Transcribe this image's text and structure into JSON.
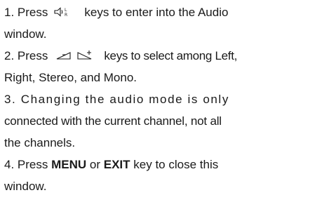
{
  "instructions": {
    "step1": {
      "before": "1. Press",
      "icon": "audio-speaker-lr-icon",
      "after": "keys to enter into the Audio",
      "cont": "window."
    },
    "step2": {
      "before": "2. Press",
      "icon_minus": "volume-minus-icon",
      "icon_plus": "volume-plus-icon",
      "after": "keys to select among Left,",
      "cont": "Right, Stereo, and Mono."
    },
    "step3": {
      "line1": "3. Changing the audio mode is only",
      "line2": "connected with the current  channel, not all",
      "line3": "the channels."
    },
    "step4": {
      "before": "4. Press",
      "menu": "MENU",
      "or": "or",
      "exit": "EXIT",
      "after": "key to close this",
      "cont": "window."
    }
  }
}
